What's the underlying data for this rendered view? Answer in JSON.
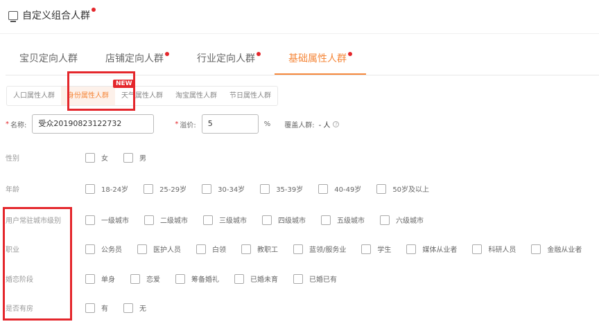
{
  "header": {
    "title": "自定义组合人群",
    "icon": "crowd-icon"
  },
  "tabs": [
    {
      "label": "宝贝定向人群",
      "dot": false
    },
    {
      "label": "店铺定向人群",
      "dot": true
    },
    {
      "label": "行业定向人群",
      "dot": true
    },
    {
      "label": "基础属性人群",
      "dot": true,
      "active": true
    }
  ],
  "subtabs": [
    {
      "label": "人口属性人群"
    },
    {
      "label": "身份属性人群",
      "active": true
    },
    {
      "label": "天气属性人群"
    },
    {
      "label": "淘宝属性人群"
    },
    {
      "label": "节日属性人群"
    }
  ],
  "new_badge": "NEW",
  "form": {
    "name_label": "名称:",
    "name_value": "受众20190823122732",
    "premium_label": "溢价:",
    "premium_value": "5",
    "percent": "%",
    "coverage_label": "覆盖人群:",
    "coverage_value": "- 人",
    "help": "?"
  },
  "rows": [
    {
      "label": "性别",
      "options": [
        "女",
        "男"
      ]
    },
    {
      "label": "年龄",
      "options": [
        "18-24岁",
        "25-29岁",
        "30-34岁",
        "35-39岁",
        "40-49岁",
        "50岁及以上"
      ]
    },
    {
      "label": "用户常驻城市级别",
      "options": [
        "一级城市",
        "二级城市",
        "三级城市",
        "四级城市",
        "五级城市",
        "六级城市"
      ]
    },
    {
      "label": "职业",
      "options": [
        "公务员",
        "医护人员",
        "白领",
        "教职工",
        "蓝领/服务业",
        "学生",
        "媒体从业者",
        "科研人员",
        "金融从业者"
      ]
    },
    {
      "label": "婚恋阶段",
      "options": [
        "单身",
        "恋爱",
        "筹备婚礼",
        "已婚未育",
        "已婚已有"
      ]
    },
    {
      "label": "是否有房",
      "options": [
        "有",
        "无"
      ]
    }
  ],
  "colors": {
    "accent": "#f5873a",
    "highlight": "#e4262b"
  }
}
